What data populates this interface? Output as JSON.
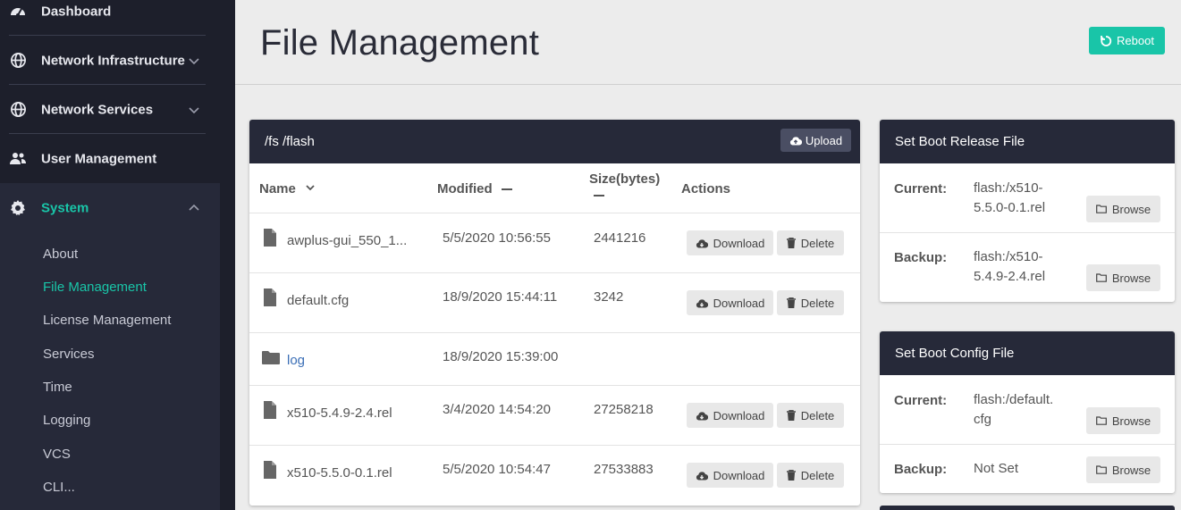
{
  "sidebar": {
    "items": [
      {
        "label": "Dashboard",
        "icon": "speedometer-icon"
      },
      {
        "label": "Network Infrastructure",
        "icon": "globe-icon"
      },
      {
        "label": "Network Services",
        "icon": "globe-icon"
      },
      {
        "label": "User Management",
        "icon": "users-icon"
      },
      {
        "label": "System",
        "icon": "gear-icon"
      }
    ],
    "system_submenu": [
      "About",
      "File Management",
      "License Management",
      "Services",
      "Time",
      "Logging",
      "VCS",
      "CLI..."
    ],
    "active_submenu": "File Management"
  },
  "header": {
    "title": "File Management",
    "reboot_label": "Reboot"
  },
  "files": {
    "path": "/fs /flash",
    "upload_label": "Upload",
    "columns": {
      "name": "Name",
      "modified": "Modified",
      "size": "Size(bytes)",
      "actions": "Actions"
    },
    "download_label": "Download",
    "delete_label": "Delete",
    "rows": [
      {
        "name": "awplus-gui_550_1...",
        "modified": "5/5/2020 10:56:55",
        "size": "2441216",
        "type": "file"
      },
      {
        "name": "default.cfg",
        "modified": "18/9/2020 15:44:11",
        "size": "3242",
        "type": "file"
      },
      {
        "name": "log",
        "modified": "18/9/2020 15:39:00",
        "size": "",
        "type": "folder"
      },
      {
        "name": "x510-5.4.9-2.4.rel",
        "modified": "3/4/2020 14:54:20",
        "size": "27258218",
        "type": "file"
      },
      {
        "name": "x510-5.5.0-0.1.rel",
        "modified": "5/5/2020 10:54:47",
        "size": "27533883",
        "type": "file"
      }
    ]
  },
  "boot_release": {
    "title": "Set Boot Release File",
    "current_label": "Current:",
    "current_value": "flash:/x510-5.5.0-0.1.rel",
    "backup_label": "Backup:",
    "backup_value": "flash:/x510-5.4.9-2.4.rel",
    "browse_label": "Browse"
  },
  "boot_config": {
    "title": "Set Boot Config File",
    "current_label": "Current:",
    "current_value": "flash:/default.cfg",
    "backup_label": "Backup:",
    "backup_value": "Not Set",
    "browse_label": "Browse"
  },
  "colors": {
    "accent": "#19c5a8",
    "sidebar": "#1d1f2b",
    "panel_header": "#262939",
    "link": "#3b6fb6"
  }
}
